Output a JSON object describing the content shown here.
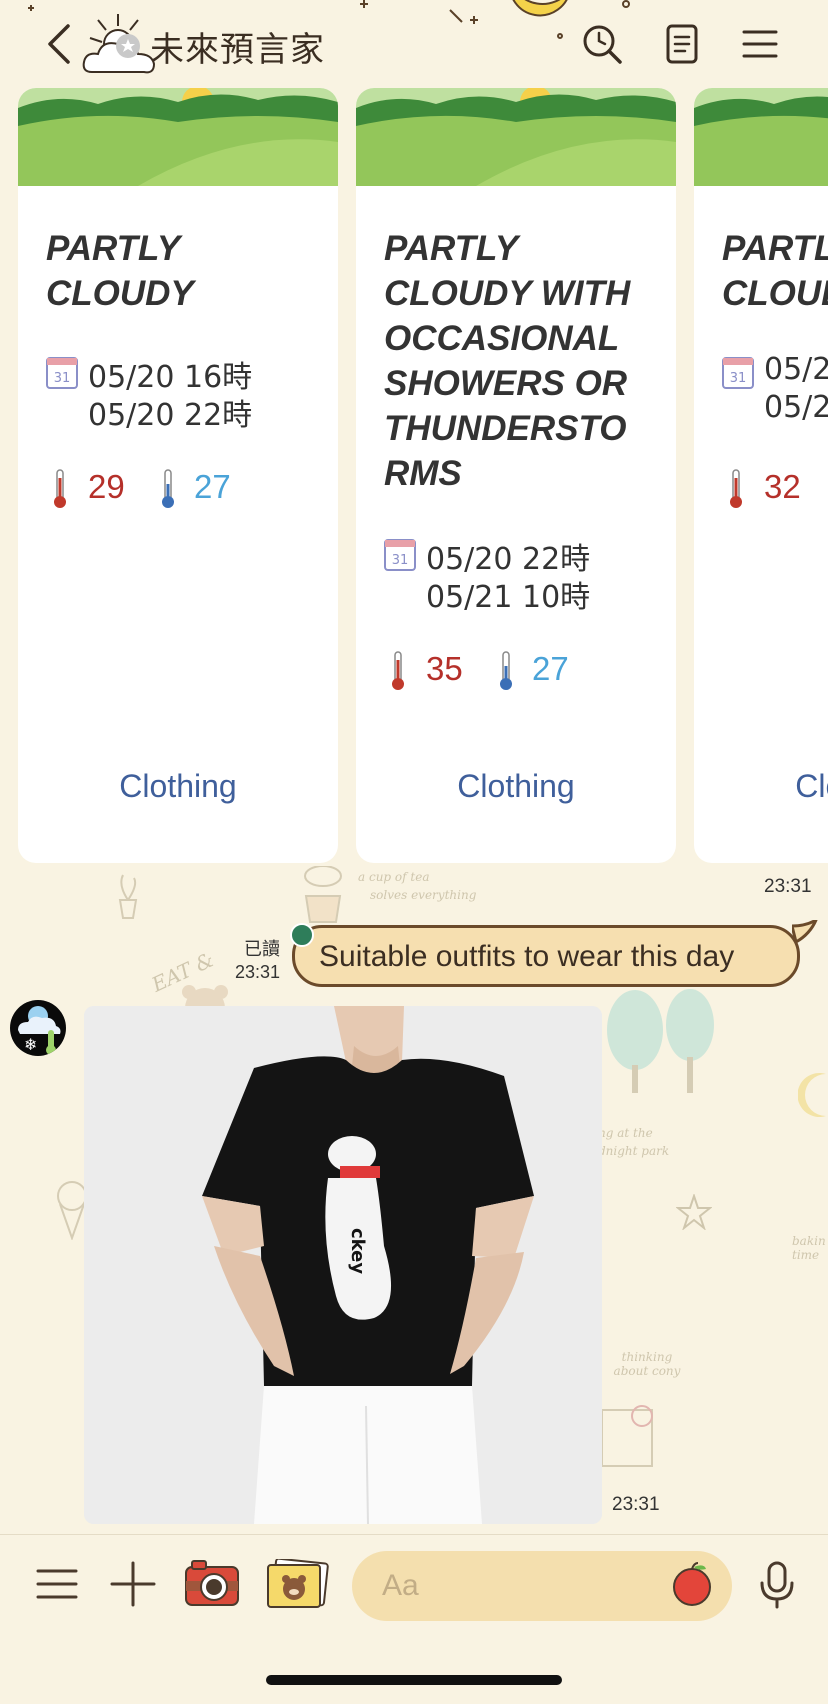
{
  "header": {
    "title": "未來預言家"
  },
  "cards": [
    {
      "title": "PARTLY CLOUDY",
      "date_start": "05/20 16時",
      "date_end": "05/20 22時",
      "temp_high": "29",
      "temp_low": "27",
      "link": "Clothing"
    },
    {
      "title": "PARTLY CLOUDY WITH OCCASIONAL SHOWERS OR THUNDERSTO RMS",
      "date_start": "05/20 22時",
      "date_end": "05/21 10時",
      "temp_high": "35",
      "temp_low": "27",
      "link": "Clothing"
    },
    {
      "title": "PARTLY CLOUDY",
      "date_start": "05/2",
      "date_end": "05/2",
      "temp_high": "32",
      "temp_low": "",
      "link": "Clothing"
    }
  ],
  "chat": {
    "carousel_time": "23:31",
    "read_label": "已讀",
    "sent_time": "23:31",
    "sent_message": "Suitable outfits to wear this day",
    "photo_time": "23:31"
  },
  "input": {
    "placeholder": "Aa"
  },
  "doodles": {
    "tea": "a cup of tea",
    "tea2": "solves everything",
    "park": "ng at the",
    "park2": "dnight park",
    "thinking": "thinking about cony",
    "eat": "EAT &",
    "baking": "bakin time"
  },
  "colors": {
    "background": "#f9f3e2",
    "bubble": "#f6dfb0",
    "link": "#3f5f9b",
    "temp_high": "#b5302a",
    "temp_low": "#4aa3d8"
  }
}
